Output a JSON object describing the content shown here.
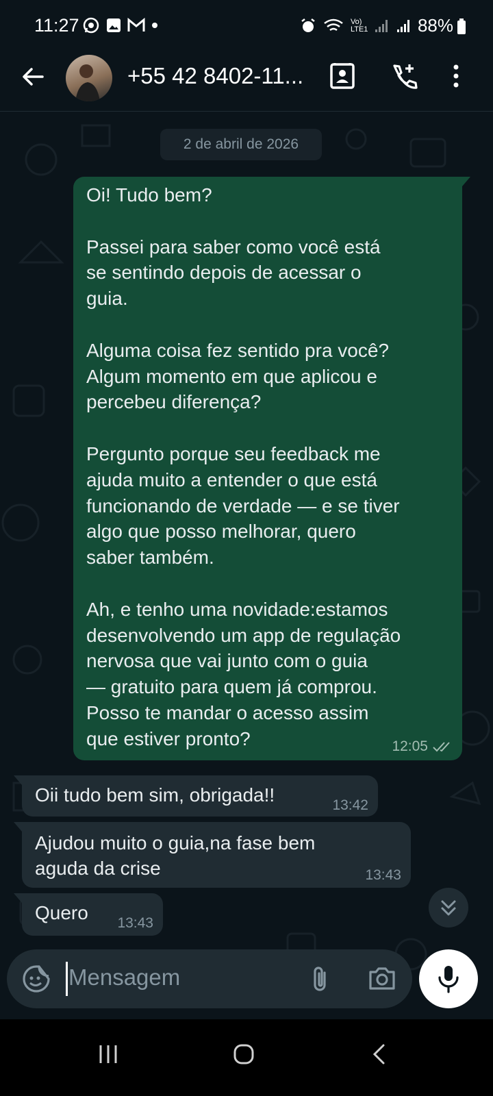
{
  "status_bar": {
    "time": "11:27",
    "battery": "88%",
    "network_label": "Vo) LTE1",
    "notification_icons": [
      "whatsapp-icon",
      "gallery-icon",
      "gmail-icon",
      "dot-icon"
    ],
    "system_icons": [
      "alarm-icon",
      "wifi-6-icon",
      "signal-icon",
      "signal-icon",
      "battery-icon"
    ]
  },
  "header": {
    "contact_name": "+55 42 8402-11...",
    "icons": [
      "back-arrow-icon",
      "avatar",
      "contact-card-icon",
      "add-call-icon",
      "more-vert-icon"
    ]
  },
  "chat": {
    "date_chip": "2 de abril de 2026",
    "outgoing": {
      "text": "Oi! Tudo bem?\n\nPassei para saber como você está\nse sentindo depois de acessar o\nguia.\n\nAlguma coisa fez sentido pra você?\nAlgum momento em que aplicou e\npercebeu diferença?\n\nPergunto porque seu feedback me\najuda muito a entender o que está\nfuncionando de verdade — e se tiver\nalgo que posso melhorar, quero\nsaber também.\n\nAh, e tenho uma novidade:estamos\ndesenvolvendo um app de regulação\nnervosa que vai junto com o guia\n— gratuito para quem já comprou.\nPosso te mandar o acesso assim\nque estiver pronto?",
      "time": "12:05",
      "status_icon": "double-check-icon"
    },
    "incoming": [
      {
        "text": "Oii tudo bem sim, obrigada!!",
        "time": "13:42"
      },
      {
        "text": "Ajudou muito o guia,na fase bem\naguda da crise",
        "time": "13:43"
      },
      {
        "text": "Quero",
        "time": "13:43"
      }
    ]
  },
  "composer": {
    "placeholder": "Mensagem",
    "icons": [
      "sticker-emoji-icon",
      "attach-icon",
      "camera-icon",
      "mic-icon"
    ]
  },
  "nav_bar": {
    "icons": [
      "recents-icon",
      "home-icon",
      "back-icon"
    ]
  },
  "colors": {
    "background": "#0b141a",
    "outgoing_bubble": "#144d37",
    "incoming_bubble": "#202c33",
    "secondary_text": "#8696a0"
  }
}
